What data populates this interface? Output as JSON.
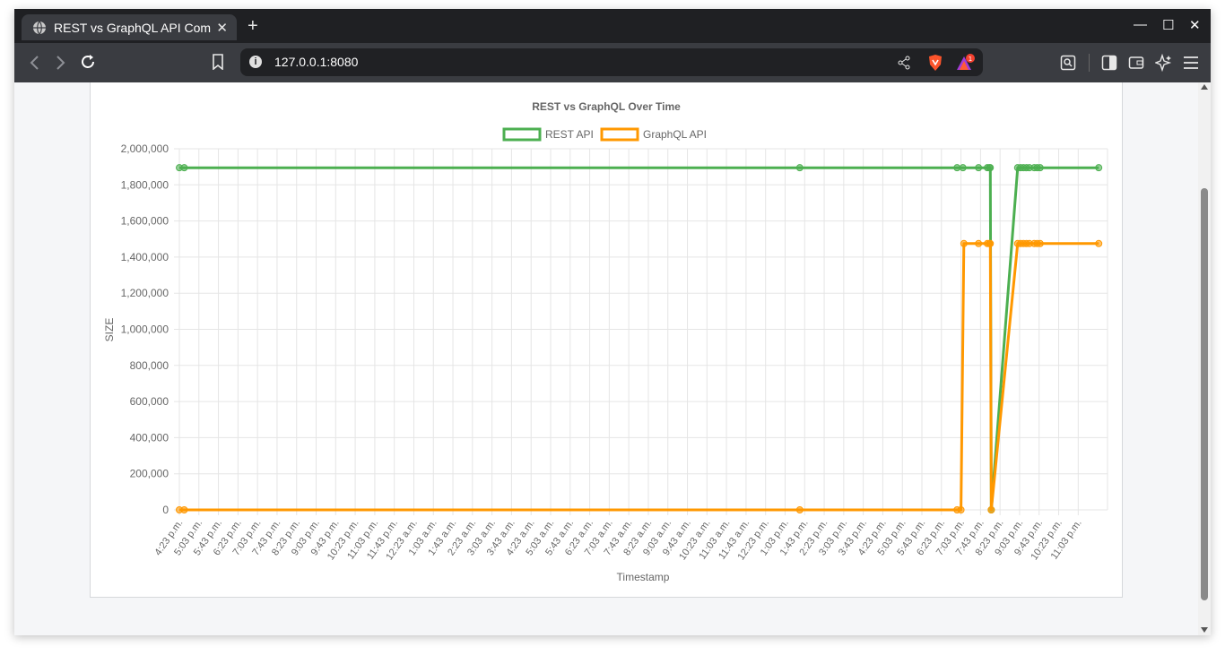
{
  "browser": {
    "tab_title": "REST vs GraphQL API Com",
    "new_tab": "+",
    "close_tab": "✕",
    "url": "127.0.0.1:8080",
    "minimize": "—",
    "maximize": "☐",
    "close": "✕",
    "info": "i"
  },
  "colors": {
    "rest": "#4caf50",
    "graphql": "#ff9800",
    "grid": "#e5e5e5",
    "text": "#666666",
    "button": "#0d6efd"
  },
  "chart_data": {
    "type": "line",
    "title": "REST vs GraphQL Over Time",
    "xlabel": "Timestamp",
    "ylabel": "SIZE",
    "ylim": [
      0,
      2000000
    ],
    "yticks": [
      "2,000,000",
      "1,800,000",
      "1,600,000",
      "1,400,000",
      "1,200,000",
      "1,000,000",
      "800,000",
      "600,000",
      "400,000",
      "200,000",
      "0"
    ],
    "grid": true,
    "legend": "top-center",
    "categories": [
      "4:23 p.m.",
      "5:03 p.m.",
      "5:43 p.m.",
      "6:23 p.m.",
      "7:03 p.m.",
      "7:43 p.m.",
      "8:23 p.m.",
      "9:03 p.m.",
      "9:43 p.m.",
      "10:23 p.m.",
      "11:03 p.m.",
      "11:43 p.m.",
      "12:23 a.m.",
      "1:03 a.m.",
      "1:43 a.m.",
      "2:23 a.m.",
      "3:03 a.m.",
      "3:43 a.m.",
      "4:23 a.m.",
      "5:03 a.m.",
      "5:43 a.m.",
      "6:23 a.m.",
      "7:03 a.m.",
      "7:43 a.m.",
      "8:23 a.m.",
      "9:03 a.m.",
      "9:43 a.m.",
      "10:23 a.m.",
      "11:03 a.m.",
      "11:43 a.m.",
      "12:23 p.m.",
      "1:03 p.m.",
      "1:43 p.m.",
      "2:23 p.m.",
      "3:03 p.m.",
      "3:43 p.m.",
      "4:23 p.m.",
      "5:03 p.m.",
      "5:43 p.m.",
      "6:23 p.m.",
      "7:03 p.m.",
      "7:43 p.m.",
      "8:23 p.m.",
      "9:03 p.m.",
      "9:43 p.m.",
      "10:23 p.m.",
      "11:03 p.m."
    ],
    "x_domain": [
      0,
      47.5
    ],
    "series": [
      {
        "name": "REST API",
        "color": "#4caf50",
        "points": [
          [
            0,
            1895000
          ],
          [
            0.25,
            1895000
          ],
          [
            31.75,
            1895000
          ],
          [
            39.8,
            1895000
          ],
          [
            40.1,
            1895000
          ],
          [
            40.9,
            1895000
          ],
          [
            41.35,
            1895000
          ],
          [
            41.45,
            1895000
          ],
          [
            41.5,
            1895000
          ],
          [
            41.55,
            0
          ],
          [
            42.9,
            1895000
          ],
          [
            43.05,
            1895000
          ],
          [
            43.2,
            1895000
          ],
          [
            43.35,
            1895000
          ],
          [
            43.5,
            1895000
          ],
          [
            43.75,
            1895000
          ],
          [
            43.9,
            1895000
          ],
          [
            44.05,
            1895000
          ],
          [
            47.05,
            1895000
          ]
        ]
      },
      {
        "name": "GraphQL API",
        "color": "#ff9800",
        "points": [
          [
            0,
            0
          ],
          [
            0.25,
            0
          ],
          [
            31.75,
            0
          ],
          [
            39.8,
            0
          ],
          [
            40.0,
            0
          ],
          [
            40.15,
            1475000
          ],
          [
            40.9,
            1475000
          ],
          [
            41.35,
            1475000
          ],
          [
            41.45,
            1475000
          ],
          [
            41.5,
            1475000
          ],
          [
            41.55,
            0
          ],
          [
            42.9,
            1475000
          ],
          [
            43.05,
            1475000
          ],
          [
            43.2,
            1475000
          ],
          [
            43.35,
            1475000
          ],
          [
            43.5,
            1475000
          ],
          [
            43.75,
            1475000
          ],
          [
            43.9,
            1475000
          ],
          [
            44.05,
            1475000
          ],
          [
            47.05,
            1475000
          ]
        ]
      }
    ]
  }
}
